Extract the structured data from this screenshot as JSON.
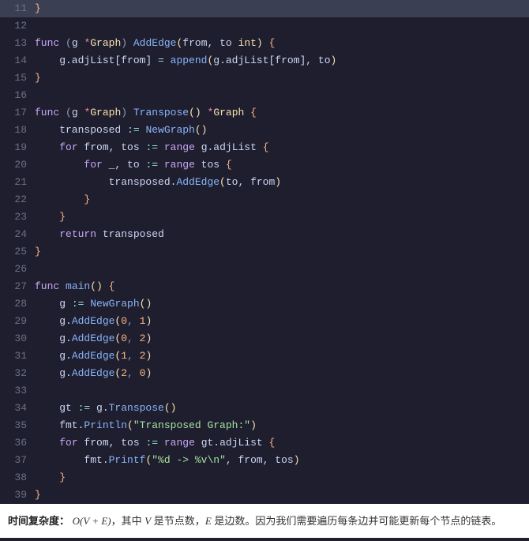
{
  "lines": {
    "n11": "11",
    "n12": "12",
    "n13": "13",
    "n14": "14",
    "n15": "15",
    "n16": "16",
    "n17": "17",
    "n18": "18",
    "n19": "19",
    "n20": "20",
    "n21": "21",
    "n22": "22",
    "n23": "23",
    "n24": "24",
    "n25": "25",
    "n26": "26",
    "n27": "27",
    "n28": "28",
    "n29": "29",
    "n30": "30",
    "n31": "31",
    "n32": "32",
    "n33": "33",
    "n34": "34",
    "n35": "35",
    "n36": "36",
    "n37": "37",
    "n38": "38",
    "n39": "39"
  },
  "code": {
    "l11": {
      "brace": "}"
    },
    "l13": {
      "kw1": "func",
      "p1": " (",
      "recv": "g ",
      "ptr": "*",
      "type": "Graph",
      "p2": ") ",
      "fn": "AddEdge",
      "p3": "(",
      "params": "from, to ",
      "ptype": "int",
      "p4": ") ",
      "brace": "{"
    },
    "l14": {
      "pre": "    g.adjList[from] ",
      "op": "=",
      "sp": " ",
      "fn": "append",
      "p1": "(",
      "args": "g.adjList[from], to",
      "p2": ")"
    },
    "l15": {
      "brace": "}"
    },
    "l17": {
      "kw1": "func",
      "p1": " (",
      "recv": "g ",
      "ptr": "*",
      "type": "Graph",
      "p2": ") ",
      "fn": "Transpose",
      "p3": "() ",
      "ptr2": "*",
      "rtype": "Graph",
      "sp": " ",
      "brace": "{"
    },
    "l18": {
      "indent": "    transposed ",
      "op": ":=",
      "sp": " ",
      "fn": "NewGraph",
      "p": "()"
    },
    "l19": {
      "indent": "    ",
      "kw": "for",
      "vars": " from, tos ",
      "op1": ":=",
      "sp1": " ",
      "kw2": "range",
      "expr": " g.adjList ",
      "brace": "{"
    },
    "l20": {
      "indent": "        ",
      "kw": "for",
      "vars": " _, to ",
      "op1": ":=",
      "sp1": " ",
      "kw2": "range",
      "expr": " tos ",
      "brace": "{"
    },
    "l21": {
      "indent": "            transposed.",
      "fn": "AddEdge",
      "p1": "(",
      "args": "to, from",
      "p2": ")"
    },
    "l22": {
      "indent": "        ",
      "brace": "}"
    },
    "l23": {
      "indent": "    ",
      "brace": "}"
    },
    "l24": {
      "indent": "    ",
      "kw": "return",
      "expr": " transposed"
    },
    "l25": {
      "brace": "}"
    },
    "l27": {
      "kw": "func",
      "sp": " ",
      "fn": "main",
      "p": "() ",
      "brace": "{"
    },
    "l28": {
      "indent": "    g ",
      "op": ":=",
      "sp": " ",
      "fn": "NewGraph",
      "p": "()"
    },
    "l29": {
      "indent": "    g.",
      "fn": "AddEdge",
      "p1": "(",
      "a": "0",
      "c": ", ",
      "b": "1",
      "p2": ")"
    },
    "l30": {
      "indent": "    g.",
      "fn": "AddEdge",
      "p1": "(",
      "a": "0",
      "c": ", ",
      "b": "2",
      "p2": ")"
    },
    "l31": {
      "indent": "    g.",
      "fn": "AddEdge",
      "p1": "(",
      "a": "1",
      "c": ", ",
      "b": "2",
      "p2": ")"
    },
    "l32": {
      "indent": "    g.",
      "fn": "AddEdge",
      "p1": "(",
      "a": "2",
      "c": ", ",
      "b": "0",
      "p2": ")"
    },
    "l34": {
      "indent": "    gt ",
      "op": ":=",
      "sp": " g.",
      "fn": "Transpose",
      "p": "()"
    },
    "l35": {
      "indent": "    fmt.",
      "fn": "Println",
      "p1": "(",
      "str": "\"Transposed Graph:\"",
      "p2": ")"
    },
    "l36": {
      "indent": "    ",
      "kw": "for",
      "vars": " from, tos ",
      "op1": ":=",
      "sp1": " ",
      "kw2": "range",
      "expr": " gt.adjList ",
      "brace": "{"
    },
    "l37": {
      "indent": "        fmt.",
      "fn": "Printf",
      "p1": "(",
      "str": "\"%d -> %v\\n\"",
      "c": ", from, tos",
      "p2": ")"
    },
    "l38": {
      "indent": "    ",
      "brace": "}"
    },
    "l39": {
      "brace": "}"
    }
  },
  "footer": {
    "label": "时间复杂度：",
    "formula": "O(V + E)",
    "t1": "，其中 ",
    "v": "V",
    "t2": " 是节点数，",
    "e": "E",
    "t3": " 是边数。因为我们需要遍历每条边并可能更新每个节点的链表。"
  }
}
